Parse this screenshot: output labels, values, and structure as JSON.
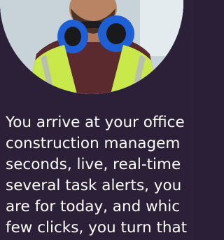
{
  "hero": {
    "photo_icon": "worker-in-hi-vis-vest-with-ear-protection"
  },
  "story": {
    "lines": [
      "You arrive at your office",
      "construction managem",
      "seconds, live, real-time",
      "several task alerts, you",
      "are for today, and whic",
      "few clicks, you turn that"
    ]
  },
  "colors": {
    "background": "#2b2038",
    "text": "#ffffff",
    "vest": "#c9e84a",
    "earmuff": "#1f5fd6"
  }
}
